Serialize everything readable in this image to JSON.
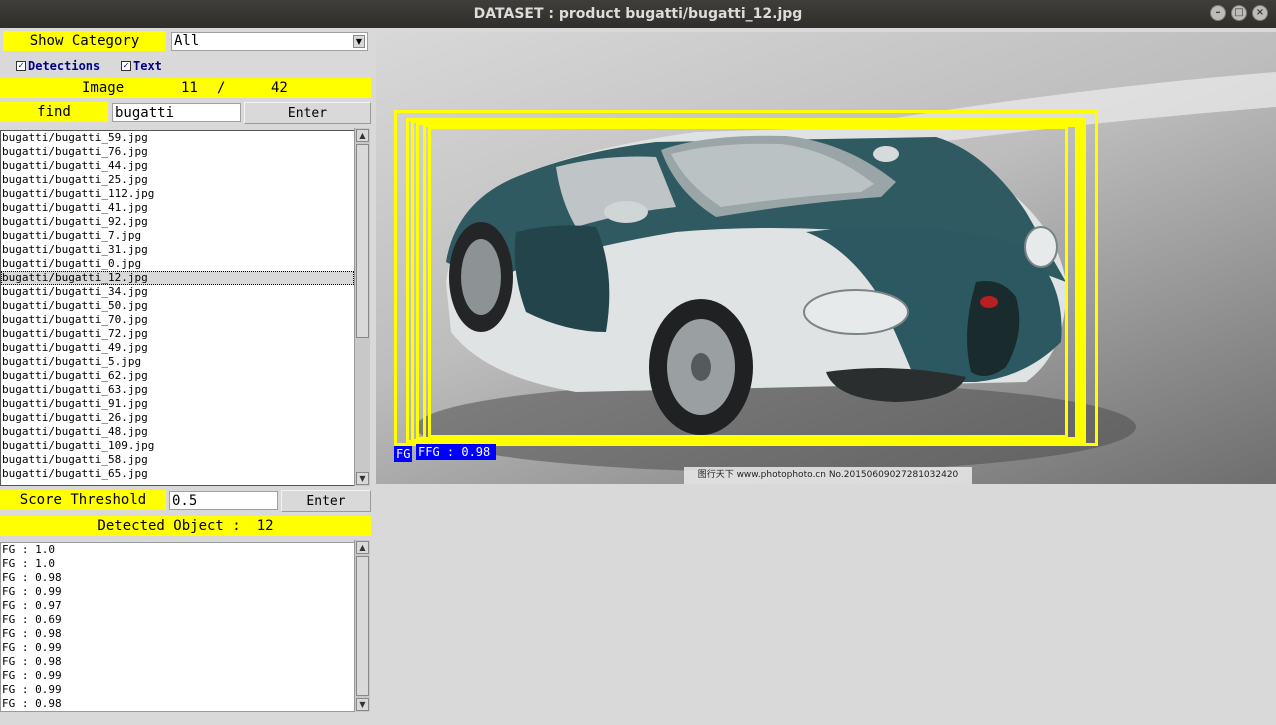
{
  "window": {
    "title": "DATASET : product   bugatti/bugatti_12.jpg",
    "buttons": [
      "minimize",
      "maximize",
      "close"
    ]
  },
  "controls": {
    "show_category_label": "Show Category",
    "category_value": "All",
    "detections_label": "Detections",
    "text_label": "Text",
    "image_label": "Image",
    "image_index": "11",
    "image_sep": "/",
    "image_total": "42",
    "find_label": "find",
    "find_value": "bugatti",
    "enter_label": "Enter",
    "score_threshold_label": "Score Threshold",
    "score_threshold_value": "0.5",
    "score_enter_label": "Enter",
    "detected_object_label": "Detected Object :",
    "detected_object_count": "12"
  },
  "file_list": {
    "selected_index": 10,
    "items": [
      "bugatti/bugatti_59.jpg",
      "bugatti/bugatti_76.jpg",
      "bugatti/bugatti_44.jpg",
      "bugatti/bugatti_25.jpg",
      "bugatti/bugatti_112.jpg",
      "bugatti/bugatti_41.jpg",
      "bugatti/bugatti_92.jpg",
      "bugatti/bugatti_7.jpg",
      "bugatti/bugatti_31.jpg",
      "bugatti/bugatti_0.jpg",
      "bugatti/bugatti_12.jpg",
      "bugatti/bugatti_34.jpg",
      "bugatti/bugatti_50.jpg",
      "bugatti/bugatti_70.jpg",
      "bugatti/bugatti_72.jpg",
      "bugatti/bugatti_49.jpg",
      "bugatti/bugatti_5.jpg",
      "bugatti/bugatti_62.jpg",
      "bugatti/bugatti_63.jpg",
      "bugatti/bugatti_91.jpg",
      "bugatti/bugatti_26.jpg",
      "bugatti/bugatti_48.jpg",
      "bugatti/bugatti_109.jpg",
      "bugatti/bugatti_58.jpg",
      "bugatti/bugatti_65.jpg"
    ]
  },
  "detections_list": [
    "FG : 1.0",
    "FG : 1.0",
    "FG : 0.98",
    "FG : 0.99",
    "FG : 0.97",
    "FG : 0.69",
    "FG : 0.98",
    "FG : 0.99",
    "FG : 0.98",
    "FG : 0.99",
    "FG : 0.99",
    "FG : 0.98"
  ],
  "image_overlay": {
    "label_left": "FG",
    "label_main": "FFG : 0.98",
    "watermark": "图行天下 www.photophoto.cn  No.20150609027281032420"
  },
  "colors": {
    "highlight": "#ffff00",
    "label_bg": "#0000ff",
    "panel_bg": "#d9d9d9"
  }
}
